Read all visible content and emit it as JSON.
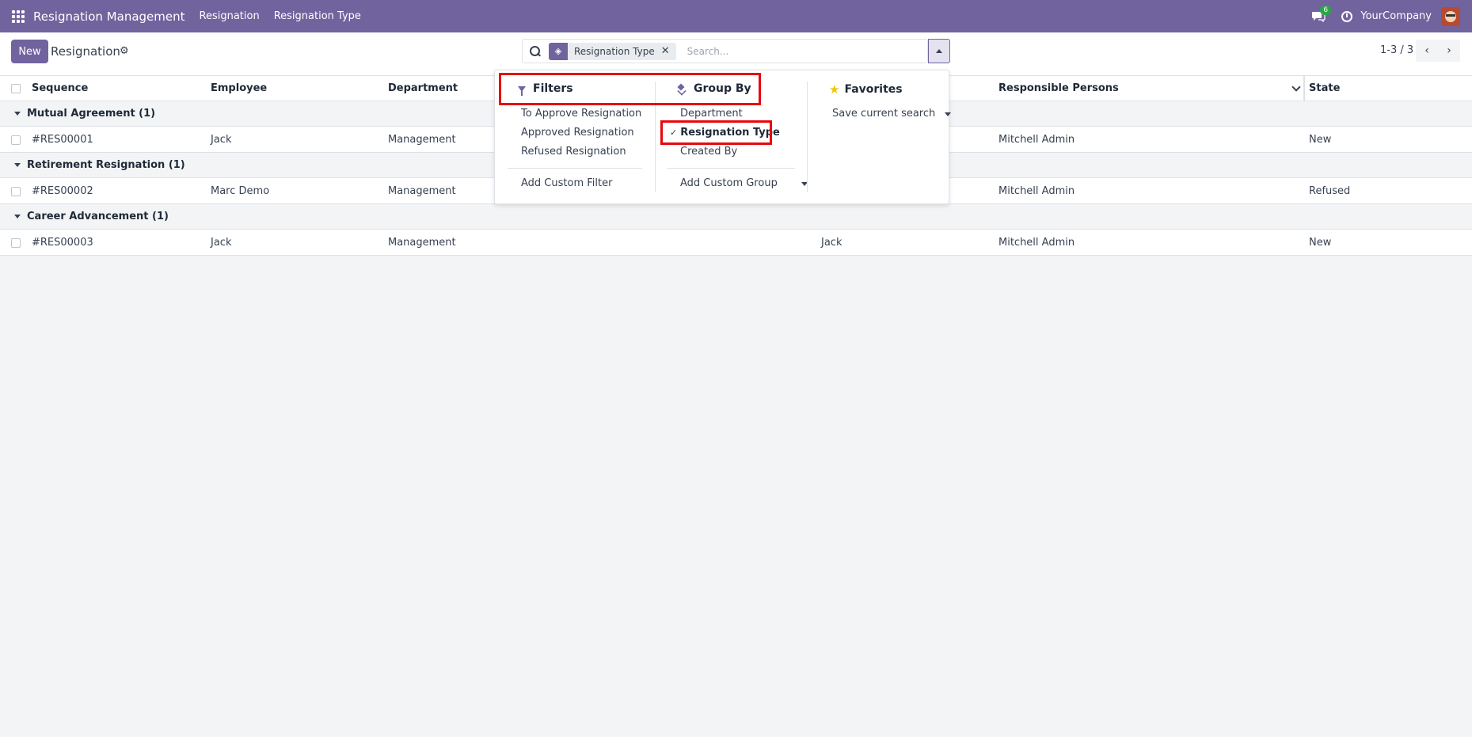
{
  "navbar": {
    "brand": "Resignation Management",
    "menus": [
      "Resignation",
      "Resignation Type"
    ],
    "chat_count": "6",
    "company": "YourCompany"
  },
  "control": {
    "new_label": "New",
    "breadcrumb": "Resignation",
    "facet_label": "Resignation Type",
    "search_placeholder": "Search...",
    "pager": "1-3 / 3"
  },
  "table": {
    "columns": {
      "sequence": "Sequence",
      "employee": "Employee",
      "department": "Department",
      "responsible": "Responsible Persons",
      "state": "State"
    },
    "groups": [
      {
        "label": "Mutual Agreement (1)",
        "rows": [
          {
            "sequence": "#RES00001",
            "employee": "Jack",
            "department": "Management",
            "extra": "",
            "responsible": "Mitchell Admin",
            "state": "New"
          }
        ]
      },
      {
        "label": "Retirement Resignation (1)",
        "rows": [
          {
            "sequence": "#RES00002",
            "employee": "Marc Demo",
            "department": "Management",
            "extra": "",
            "responsible": "Mitchell Admin",
            "state": "Refused"
          }
        ]
      },
      {
        "label": "Career Advancement (1)",
        "rows": [
          {
            "sequence": "#RES00003",
            "employee": "Jack",
            "department": "Management",
            "extra": "Jack",
            "responsible": "Mitchell Admin",
            "state": "New"
          }
        ]
      }
    ]
  },
  "dropdown": {
    "filters": {
      "title": "Filters",
      "items": [
        "To Approve Resignation",
        "Approved Resignation",
        "Refused Resignation"
      ],
      "custom": "Add Custom Filter"
    },
    "groupby": {
      "title": "Group By",
      "items": [
        "Department",
        "Resignation Type",
        "Created By"
      ],
      "selected": "Resignation Type",
      "custom": "Add Custom Group"
    },
    "favorites": {
      "title": "Favorites",
      "save": "Save current search"
    }
  },
  "colors": {
    "brand": "#71639e",
    "highlight": "#e8070e",
    "badge": "#28a745"
  }
}
